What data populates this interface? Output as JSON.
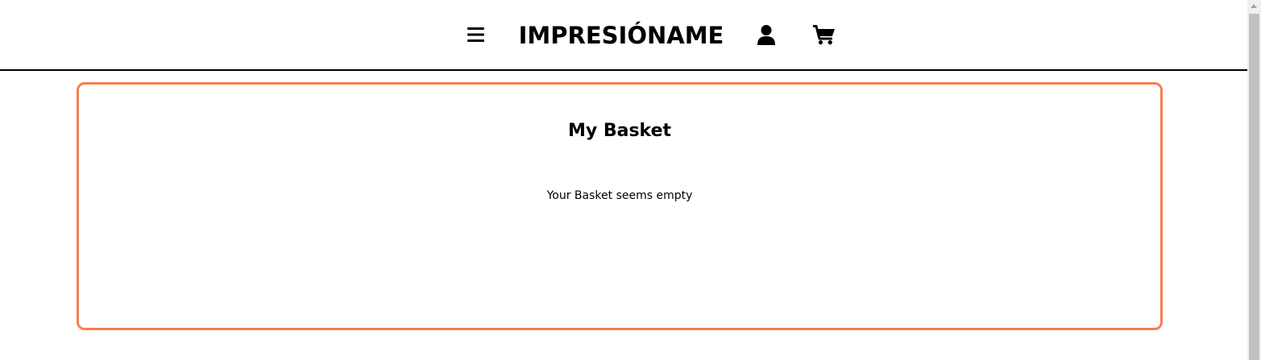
{
  "header": {
    "brand": "IMPRESIÓNAME",
    "menu_icon": "menu-icon",
    "user_icon": "user-icon",
    "cart_icon": "cart-icon"
  },
  "basket": {
    "title": "My Basket",
    "empty_message": "Your Basket seems empty"
  },
  "colors": {
    "accent_border": "#f47f4f",
    "header_rule": "#000000",
    "text": "#000000",
    "background": "#ffffff"
  }
}
